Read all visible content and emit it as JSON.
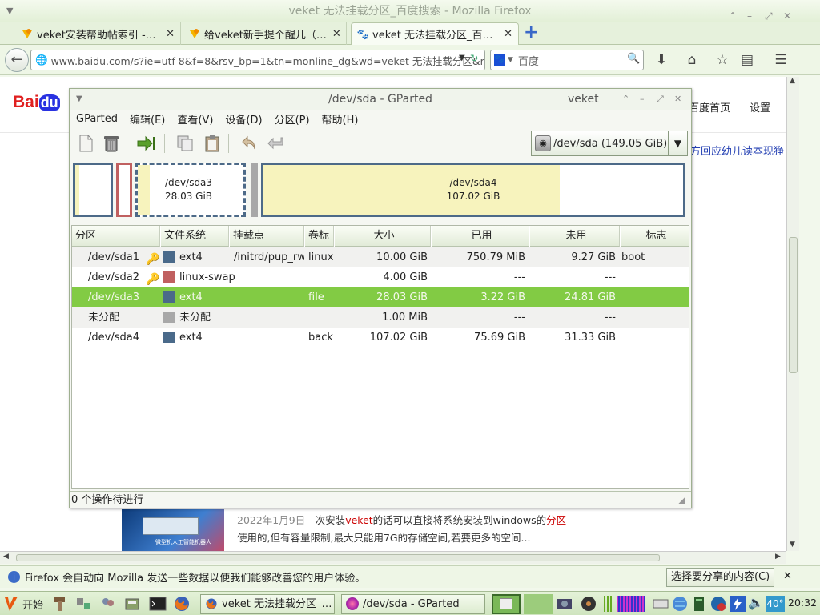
{
  "firefox": {
    "window_title": "veket 无法挂载分区_百度搜索 - Mozilla Firefox",
    "tabs": [
      {
        "label": "veket安装帮助帖索引 -…"
      },
      {
        "label": "给veket新手提个醒儿（…"
      },
      {
        "label": "veket 无法挂载分区_百…"
      }
    ],
    "new_tab_symbol": "+",
    "url": "www.baidu.com/s?ie=utf-8&f=8&rsv_bp=1&tn=monline_dg&wd=veket 无法挂载分区&rs",
    "search_placeholder": "百度",
    "notification": "Firefox 会自动向 Mozilla 发送一些数据以便我们能够改善您的用户体验。",
    "notification_button": "选择要分享的内容(C)"
  },
  "baidu": {
    "logo_text": "Bai",
    "logo_du": "du",
    "top_links": [
      "百度首页",
      "设置"
    ],
    "side_snippet": "方回应幼儿读本现狰",
    "result": {
      "date": "2022年1月9日",
      "line1_pre": " - 次安装",
      "line1_hl": "veket",
      "line1_mid": "的话可以直接将系统安装到windows的",
      "line1_hl2": "分区",
      "line2": "使用的,但有容量限制,最大只能用7G的存储空间,若要更多的空间...",
      "thumb_caption": "微型机人工智能机器人"
    }
  },
  "gparted": {
    "title": "/dev/sda - GParted",
    "host": "veket",
    "menu": [
      "GParted",
      "编辑(E)",
      "查看(V)",
      "设备(D)",
      "分区(P)",
      "帮助(H)"
    ],
    "device_selector": "/dev/sda  (149.05 GiB)",
    "graph": {
      "sda3_name": "/dev/sda3",
      "sda3_size": "28.03 GiB",
      "sda4_name": "/dev/sda4",
      "sda4_size": "107.02 GiB",
      "sda4_used_fraction": 0.707
    },
    "columns": [
      "分区",
      "文件系统",
      "挂载点",
      "卷标",
      "大小",
      "已用",
      "未用",
      "标志"
    ],
    "rows": [
      {
        "partition": "/dev/sda1",
        "fs": "ext4",
        "fs_color": "#4a6a8a",
        "mount": "/initrd/pup_rw",
        "label": "linux",
        "size": "10.00 GiB",
        "used": "750.79 MiB",
        "unused": "9.27 GiB",
        "flags": "boot",
        "locked": true
      },
      {
        "partition": "/dev/sda2",
        "fs": "linux-swap",
        "fs_color": "#c06060",
        "mount": "",
        "label": "",
        "size": "4.00 GiB",
        "used": "---",
        "unused": "---",
        "flags": "",
        "locked": true
      },
      {
        "partition": "/dev/sda3",
        "fs": "ext4",
        "fs_color": "#4a6a8a",
        "mount": "",
        "label": "file",
        "size": "28.03 GiB",
        "used": "3.22 GiB",
        "unused": "24.81 GiB",
        "flags": "",
        "locked": false
      },
      {
        "partition": "未分配",
        "fs": "未分配",
        "fs_color": "#a8a8a8",
        "mount": "",
        "label": "",
        "size": "1.00 MiB",
        "used": "---",
        "unused": "---",
        "flags": "",
        "locked": false
      },
      {
        "partition": "/dev/sda4",
        "fs": "ext4",
        "fs_color": "#4a6a8a",
        "mount": "",
        "label": "back",
        "size": "107.02 GiB",
        "used": "75.69 GiB",
        "unused": "31.33 GiB",
        "flags": "",
        "locked": false
      }
    ],
    "selected_row": 2,
    "status": "0 个操作待进行"
  },
  "taskbar": {
    "start_label": "开始",
    "tasks": [
      "veket 无法挂载分区_…",
      "/dev/sda - GParted"
    ],
    "temperature": "40°",
    "clock": "20:32"
  },
  "colors": {
    "selection": "#82cb44",
    "partition_border": "#4d6a88",
    "used_space": "#f7f3bd",
    "swap_border": "#c06060"
  }
}
